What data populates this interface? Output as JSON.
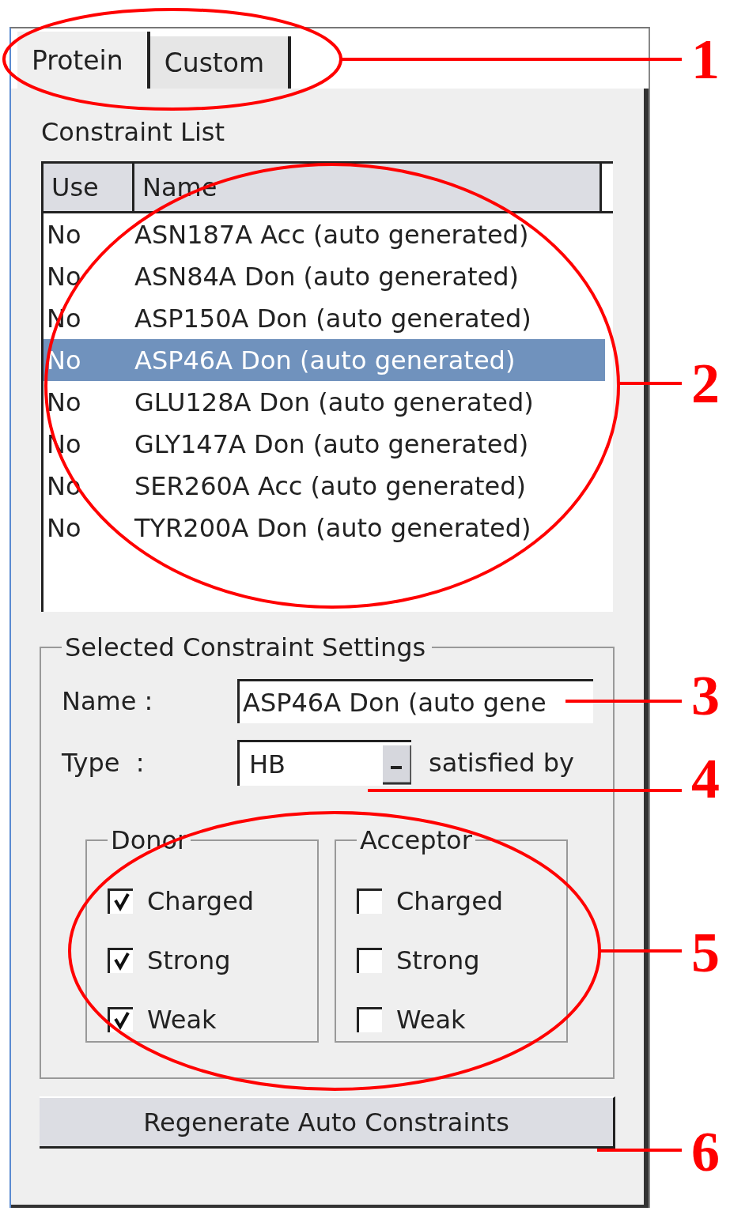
{
  "tabs": [
    {
      "label": "Protein",
      "selected": true
    },
    {
      "label": "Custom",
      "selected": false
    }
  ],
  "constraint_list": {
    "title": "Constraint List",
    "columns": [
      "Use",
      "Name"
    ],
    "rows": [
      {
        "use": "No",
        "name": "ASN187A Acc (auto generated)",
        "selected": false
      },
      {
        "use": "No",
        "name": "ASN84A Don (auto generated)",
        "selected": false
      },
      {
        "use": "No",
        "name": "ASP150A Don (auto generated)",
        "selected": false
      },
      {
        "use": "No",
        "name": "ASP46A Don (auto generated)",
        "selected": true
      },
      {
        "use": "No",
        "name": "GLU128A Don (auto generated)",
        "selected": false
      },
      {
        "use": "No",
        "name": "GLY147A Don (auto generated)",
        "selected": false
      },
      {
        "use": "No",
        "name": "SER260A Acc (auto generated)",
        "selected": false
      },
      {
        "use": "No",
        "name": "TYR200A Don (auto generated)",
        "selected": false
      }
    ]
  },
  "settings": {
    "title": "Selected Constraint Settings",
    "name_label": "Name :",
    "name_value": "ASP46A Don (auto gene",
    "type_label": "Type  :",
    "type_value": "HB",
    "type_suffix": "satisfied by",
    "groups": [
      {
        "title": "Donor",
        "options": [
          {
            "label": "Charged",
            "checked": true
          },
          {
            "label": "Strong",
            "checked": true
          },
          {
            "label": "Weak",
            "checked": true
          }
        ]
      },
      {
        "title": "Acceptor",
        "options": [
          {
            "label": "Charged",
            "checked": false
          },
          {
            "label": "Strong",
            "checked": false
          },
          {
            "label": "Weak",
            "checked": false
          }
        ]
      }
    ]
  },
  "button": "Regenerate Auto Constraints",
  "annotations": [
    {
      "label": "1",
      "kind": "ellipse"
    },
    {
      "label": "2",
      "kind": "ellipse"
    },
    {
      "label": "3",
      "kind": "line"
    },
    {
      "label": "4",
      "kind": "line"
    },
    {
      "label": "5",
      "kind": "ellipse"
    },
    {
      "label": "6",
      "kind": "line"
    }
  ]
}
